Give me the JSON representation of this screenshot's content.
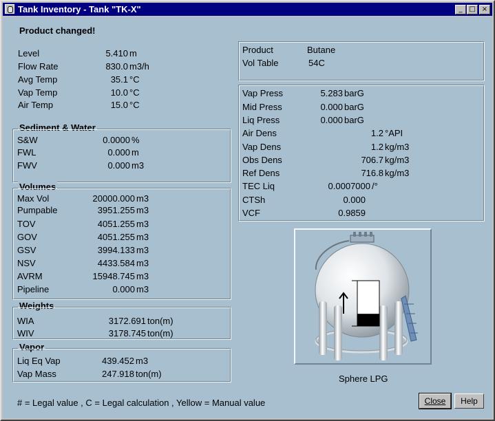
{
  "window": {
    "title": "Tank Inventory - Tank \"TK-X\""
  },
  "status_message": "Product changed!",
  "gauges": [
    {
      "label": "Level",
      "value": "5.410",
      "unit": "m"
    },
    {
      "label": "Flow Rate",
      "value": "830.0",
      "unit": "m3/h"
    },
    {
      "label": "Avg Temp",
      "value": "35.1",
      "unit": "°C"
    },
    {
      "label": "Vap Temp",
      "value": "10.0",
      "unit": "°C"
    },
    {
      "label": "Air Temp",
      "value": "15.0",
      "unit": "°C"
    }
  ],
  "sediment": {
    "title": "Sediment & Water",
    "rows": [
      {
        "label": "S&W",
        "value": "0.0000",
        "unit": "%"
      },
      {
        "label": "FWL",
        "value": "0.000",
        "unit": "m"
      },
      {
        "label": "FWV",
        "value": "0.000",
        "unit": "m3"
      }
    ]
  },
  "volumes": {
    "title": "Volumes",
    "rows": [
      {
        "label": "Max Vol",
        "value": "20000.000",
        "unit": "m3"
      },
      {
        "label": "Pumpable",
        "value": "3951.255",
        "unit": "m3"
      },
      {
        "label": "TOV",
        "value": "4051.255",
        "unit": "m3"
      },
      {
        "label": "GOV",
        "value": "4051.255",
        "unit": "m3"
      },
      {
        "label": "GSV",
        "value": "3994.133",
        "unit": "m3"
      },
      {
        "label": "NSV",
        "value": "4433.584",
        "unit": "m3"
      },
      {
        "label": "AVRM",
        "value": "15948.745",
        "unit": "m3"
      },
      {
        "label": "Pipeline",
        "value": "0.000",
        "unit": "m3"
      }
    ]
  },
  "weights": {
    "title": "Weights",
    "rows": [
      {
        "label": "WIA",
        "value": "3172.691",
        "unit": "ton(m)"
      },
      {
        "label": "WIV",
        "value": "3178.745",
        "unit": "ton(m)"
      }
    ]
  },
  "vapor": {
    "title": "Vapor",
    "rows": [
      {
        "label": "Liq Eq Vap",
        "value": "439.452",
        "unit": "m3"
      },
      {
        "label": "Vap Mass",
        "value": "247.918",
        "unit": "ton(m)"
      }
    ]
  },
  "product": {
    "rows": [
      {
        "label": "Product",
        "value": "Butane"
      },
      {
        "label": "Vol Table",
        "value": "54C"
      }
    ]
  },
  "properties": [
    {
      "label": "Vap Press",
      "value": "5.283",
      "unit": "barG"
    },
    {
      "label": "Mid Press",
      "value": "0.000",
      "unit": "barG"
    },
    {
      "label": "Liq Press",
      "value": "0.000",
      "unit": "barG"
    },
    {
      "label": "Air Dens",
      "value": "1.2",
      "unit": "°API"
    },
    {
      "label": "Vap Dens",
      "value": "1.2",
      "unit": "kg/m3"
    },
    {
      "label": "Obs Dens",
      "value": "706.7",
      "unit": "kg/m3"
    },
    {
      "label": "Ref Dens",
      "value": "716.8",
      "unit": "kg/m3"
    },
    {
      "label": "TEC Liq",
      "value": "0.0007000",
      "unit": "/°"
    },
    {
      "label": "CTSh",
      "value": "0.000",
      "unit": ""
    },
    {
      "label": "VCF",
      "value": "0.9859",
      "unit": ""
    }
  ],
  "tank_image": {
    "caption": "Sphere LPG",
    "fill_level_fraction": 0.27,
    "trend": "rising"
  },
  "legend": "# = Legal value , C = Legal calculation , Yellow = Manual value",
  "buttons": {
    "close": "Close",
    "help": "Help"
  },
  "titlebar_buttons": {
    "minimize": "_",
    "maximize": "□",
    "close": "×"
  },
  "colors": {
    "background": "#a7bfcf",
    "titlebar": "#000080",
    "liquid": "#000000"
  }
}
